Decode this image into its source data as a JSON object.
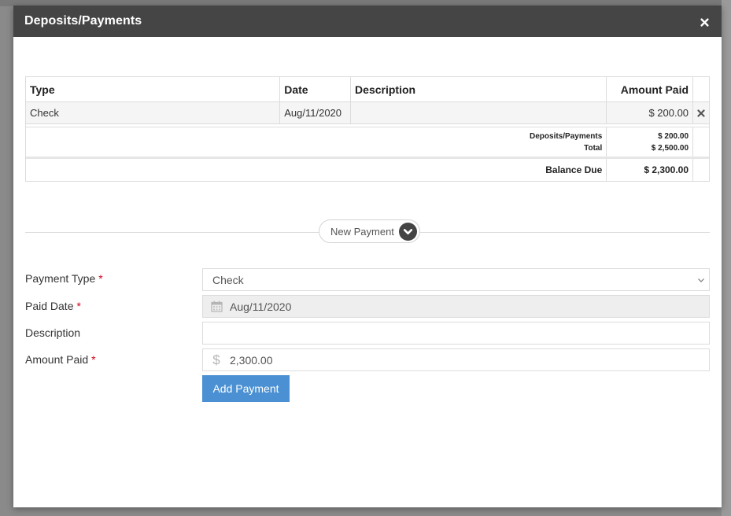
{
  "modal": {
    "title": "Deposits/Payments"
  },
  "payments_table": {
    "headers": {
      "type": "Type",
      "date": "Date",
      "description": "Description",
      "amount_paid": "Amount Paid"
    },
    "rows": [
      {
        "type": "Check",
        "date": "Aug/11/2020",
        "description": "",
        "amount_paid": "$ 200.00"
      }
    ],
    "totals": {
      "deposits_label": "Deposits/Payments",
      "deposits_value": "$ 200.00",
      "total_label": "Total",
      "total_value": "$ 2,500.00"
    },
    "balance": {
      "label": "Balance Due",
      "value": "$ 2,300.00"
    }
  },
  "new_payment": {
    "toggle_label": "New Payment"
  },
  "form": {
    "payment_type": {
      "label": "Payment Type",
      "required_mark": "*",
      "value": "Check"
    },
    "paid_date": {
      "label": "Paid Date",
      "required_mark": "*",
      "value": "Aug/11/2020"
    },
    "description": {
      "label": "Description",
      "value": ""
    },
    "amount_paid": {
      "label": "Amount Paid",
      "required_mark": "*",
      "value": "2,300.00",
      "prefix": "$"
    },
    "submit_label": "Add Payment"
  },
  "icons": {
    "close": "close-icon",
    "remove_row": "remove-icon",
    "expand": "chevron-down-icon",
    "calendar": "calendar-icon",
    "currency": "dollar-icon",
    "select": "chevron-down-icon"
  },
  "colors": {
    "header_bg": "#454545",
    "primary_button": "#4a90d2",
    "required": "#d0021b"
  }
}
